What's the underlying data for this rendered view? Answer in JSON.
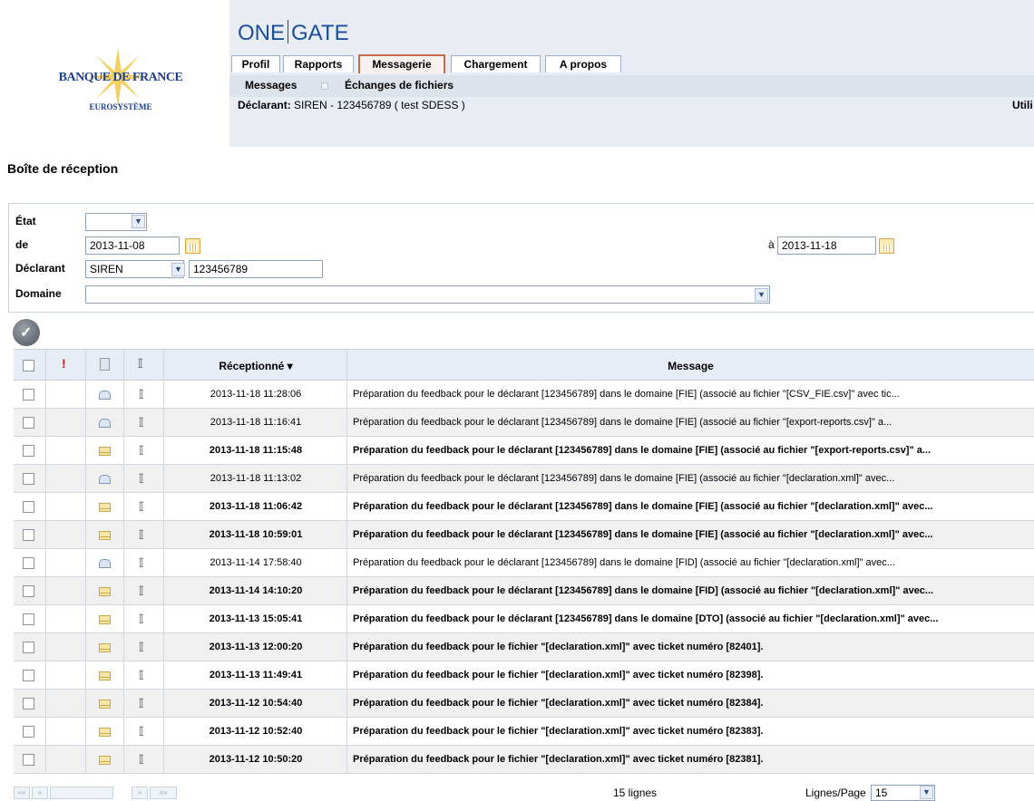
{
  "brand": {
    "name": "BANQUE DE FRANCE",
    "sub": "EUROSYSTÈME",
    "app": [
      "ONE",
      "GATE"
    ]
  },
  "tabs": [
    "Profil",
    "Rapports",
    "Messagerie",
    "Chargement",
    "A propos"
  ],
  "subnav": [
    "Messages",
    "Échanges de fichiers"
  ],
  "declarant_line": {
    "label": "Déclarant:",
    "value": "SIREN - 123456789 ( test SDESS )"
  },
  "user_label": "Utili",
  "page_title": "Boîte de réception",
  "filters": {
    "etat_label": "État",
    "etat_value": "",
    "de_label": "de",
    "de_value": "2013-11-08",
    "a_label": "à",
    "a_value": "2013-11-18",
    "declarant_label": "Déclarant",
    "declarant_type": "SIREN",
    "declarant_id": "123456789",
    "domaine_label": "Domaine",
    "domaine_value": ""
  },
  "table": {
    "col_received": "Réceptionné ▾",
    "col_message": "Message",
    "rows": [
      {
        "date": "2013-11-18 11:28:06",
        "msg": "Préparation du feedback pour le déclarant [123456789] dans le domaine [FIE] (associé au fichier \"[CSV_FIE.csv]\" avec tic...",
        "read": true
      },
      {
        "date": "2013-11-18 11:16:41",
        "msg": "Préparation du feedback pour le déclarant [123456789] dans le domaine [FIE] (associé au fichier \"[export-reports.csv]\" a...",
        "read": true
      },
      {
        "date": "2013-11-18 11:15:48",
        "msg": "Préparation du feedback pour le déclarant [123456789] dans le domaine [FIE] (associé au fichier \"[export-reports.csv]\" a...",
        "read": false
      },
      {
        "date": "2013-11-18 11:13:02",
        "msg": "Préparation du feedback pour le déclarant [123456789] dans le domaine [FIE] (associé au fichier \"[declaration.xml]\" avec...",
        "read": true
      },
      {
        "date": "2013-11-18 11:06:42",
        "msg": "Préparation du feedback pour le déclarant [123456789] dans le domaine [FIE] (associé au fichier \"[declaration.xml]\" avec...",
        "read": false
      },
      {
        "date": "2013-11-18 10:59:01",
        "msg": "Préparation du feedback pour le déclarant [123456789] dans le domaine [FIE] (associé au fichier \"[declaration.xml]\" avec...",
        "read": false
      },
      {
        "date": "2013-11-14 17:58:40",
        "msg": "Préparation du feedback pour le déclarant [123456789] dans le domaine [FID] (associé au fichier \"[declaration.xml]\" avec...",
        "read": true
      },
      {
        "date": "2013-11-14 14:10:20",
        "msg": "Préparation du feedback pour le déclarant [123456789] dans le domaine [FID] (associé au fichier \"[declaration.xml]\" avec...",
        "read": false
      },
      {
        "date": "2013-11-13 15:05:41",
        "msg": "Préparation du feedback pour le déclarant [123456789] dans le domaine [DTO] (associé au fichier \"[declaration.xml]\" avec...",
        "read": false
      },
      {
        "date": "2013-11-13 12:00:20",
        "msg": "Préparation du feedback pour le fichier \"[declaration.xml]\" avec ticket numéro [82401].",
        "read": false
      },
      {
        "date": "2013-11-13 11:49:41",
        "msg": "Préparation du feedback pour le fichier \"[declaration.xml]\" avec ticket numéro [82398].",
        "read": false
      },
      {
        "date": "2013-11-12 10:54:40",
        "msg": "Préparation du feedback pour le fichier \"[declaration.xml]\" avec ticket numéro [82384].",
        "read": false
      },
      {
        "date": "2013-11-12 10:52:40",
        "msg": "Préparation du feedback pour le fichier \"[declaration.xml]\" avec ticket numéro [82383].",
        "read": false
      },
      {
        "date": "2013-11-12 10:50:20",
        "msg": "Préparation du feedback pour le fichier \"[declaration.xml]\" avec ticket numéro [82381].",
        "read": false
      }
    ]
  },
  "footer": {
    "count": "15 lignes",
    "perpage_label": "Lignes/Page",
    "perpage_value": "15"
  },
  "colors": {
    "accent": "#c86a4d",
    "brand": "#1c4e9c",
    "header_bg": "#e8edf3"
  }
}
